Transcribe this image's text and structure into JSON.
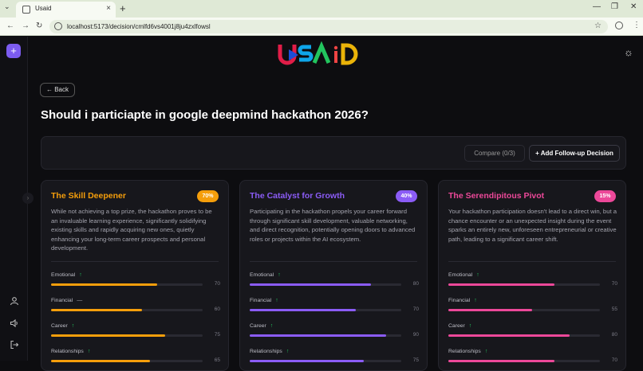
{
  "browser": {
    "tab_title": "Usaid",
    "url": "localhost:5173/decision/cmlfd6vs4001j8ju4zxlfowsl"
  },
  "app": {
    "logo_text": "USAID"
  },
  "page": {
    "back_label": "← Back",
    "title": "Should i particiapte in google deepmind hackathon 2026?",
    "compare_label": "Compare (0/3)",
    "follow_up_label": "+ Add Follow-up Decision"
  },
  "cards": [
    {
      "title": "The Skill Deepener",
      "percent": "70%",
      "color": "#f59e0b",
      "description": "While not achieving a top prize, the hackathon proves to be an invaluable learning experience, significantly solidifying existing skills and rapidly acquiring new ones, quietly enhancing your long-term career prospects and personal development.",
      "metrics": [
        {
          "label": "Emotional",
          "trend": "↑",
          "value": 70
        },
        {
          "label": "Financial",
          "trend": "—",
          "value": 60
        },
        {
          "label": "Career",
          "trend": "↑",
          "value": 75
        },
        {
          "label": "Relationships",
          "trend": "↑",
          "value": 65
        }
      ]
    },
    {
      "title": "The Catalyst for Growth",
      "percent": "40%",
      "color": "#8b5cf6",
      "description": "Participating in the hackathon propels your career forward through significant skill development, valuable networking, and direct recognition, potentially opening doors to advanced roles or projects within the AI ecosystem.",
      "metrics": [
        {
          "label": "Emotional",
          "trend": "↑",
          "value": 80
        },
        {
          "label": "Financial",
          "trend": "↑",
          "value": 70
        },
        {
          "label": "Career",
          "trend": "↑",
          "value": 90
        },
        {
          "label": "Relationships",
          "trend": "↑",
          "value": 75
        }
      ]
    },
    {
      "title": "The Serendipitous Pivot",
      "percent": "15%",
      "color": "#ec4899",
      "description": "Your hackathon participation doesn't lead to a direct win, but a chance encounter or an unexpected insight during the event sparks an entirely new, unforeseen entrepreneurial or creative path, leading to a significant career shift.",
      "metrics": [
        {
          "label": "Emotional",
          "trend": "↑",
          "value": 70
        },
        {
          "label": "Financial",
          "trend": "↑",
          "value": 55
        },
        {
          "label": "Career",
          "trend": "↑",
          "value": 80
        },
        {
          "label": "Relationships",
          "trend": "↑",
          "value": 70
        }
      ]
    }
  ]
}
